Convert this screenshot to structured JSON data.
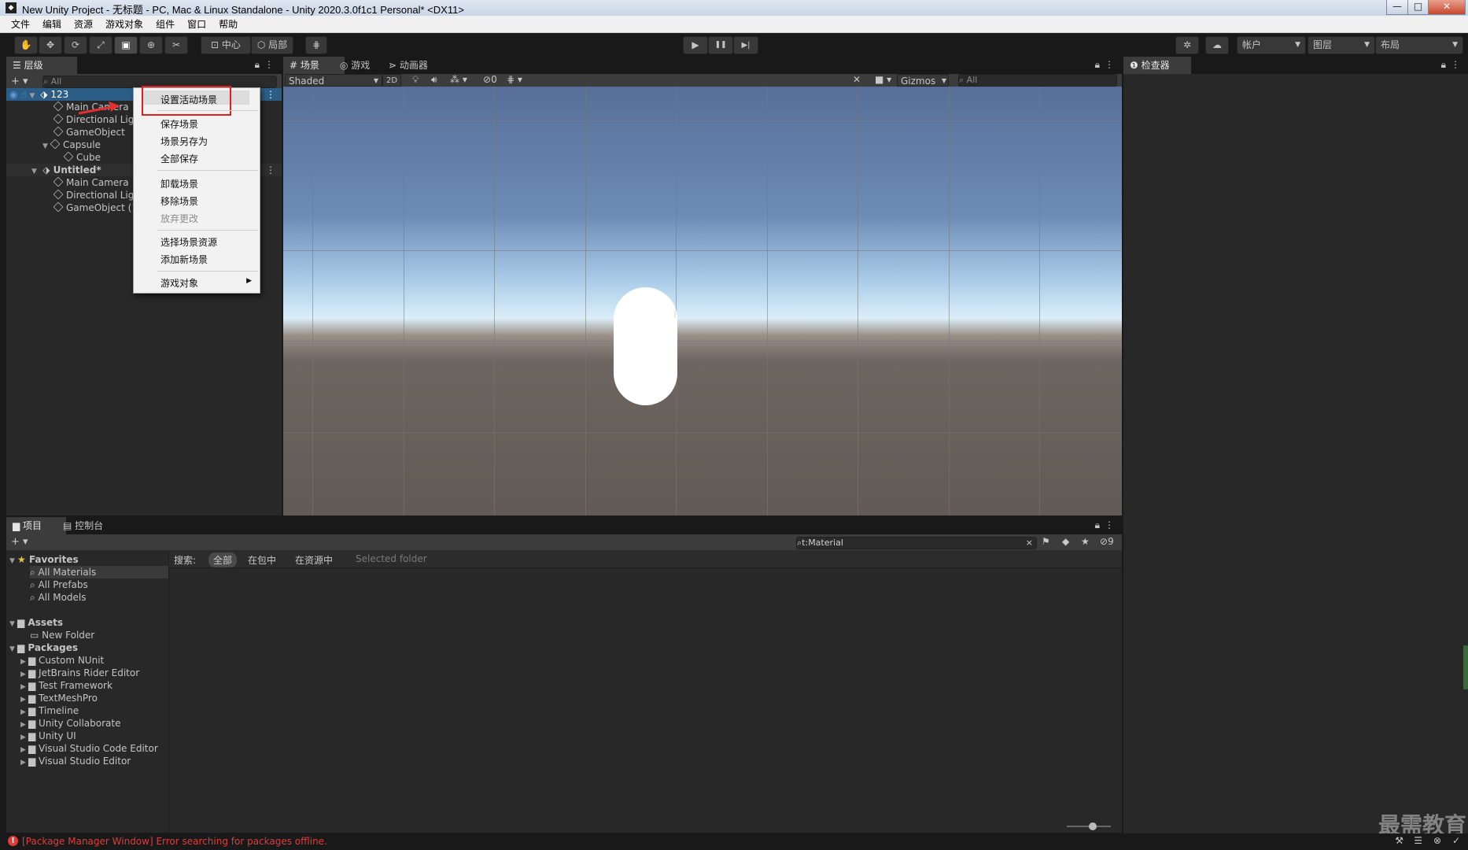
{
  "window": {
    "title": "New Unity Project - 无标题 - PC, Mac & Linux Standalone - Unity 2020.3.0f1c1 Personal* <DX11>",
    "minimize": "—",
    "maximize": "□",
    "close": "✕"
  },
  "menu": [
    "文件",
    "编辑",
    "资源",
    "游戏对象",
    "组件",
    "窗口",
    "帮助"
  ],
  "toolbar": {
    "center": "中心",
    "local": "局部",
    "account": "帐户",
    "layers": "图层",
    "layout": "布局",
    "play": "▶",
    "pause": "❚❚",
    "step": "▶|"
  },
  "hierarchy": {
    "tab": "层级",
    "search_placeholder": "All",
    "add": "+ ▾",
    "scene1": {
      "name": "123",
      "items": [
        "Main Camera",
        "Directional Light",
        "GameObject",
        "Capsule",
        "Cube"
      ]
    },
    "scene2": {
      "name": "Untitled*",
      "items": [
        "Main Camera",
        "Directional Light",
        "GameObject (1)"
      ]
    }
  },
  "context_menu": {
    "items": [
      {
        "label": "设置活动场景",
        "disabled": false,
        "highlight": true
      },
      {
        "label": "保存场景",
        "disabled": false
      },
      {
        "label": "场景另存为",
        "disabled": false
      },
      {
        "label": "全部保存",
        "disabled": false
      },
      {
        "label": "卸载场景",
        "disabled": false
      },
      {
        "label": "移除场景",
        "disabled": false
      },
      {
        "label": "放弃更改",
        "disabled": true
      },
      {
        "label": "选择场景资源",
        "disabled": false
      },
      {
        "label": "添加新场景",
        "disabled": false
      },
      {
        "label": "游戏对象",
        "disabled": false,
        "submenu": true
      }
    ],
    "highlight_color": "#e02020"
  },
  "scene_panel": {
    "tabs": [
      "场景",
      "游戏",
      "动画器"
    ],
    "shading": "Shaded",
    "mode_2d": "2D",
    "hidden_count": "0",
    "gizmos": "Gizmos",
    "search_placeholder": "All",
    "sky_color": "#6c8cb6",
    "ground_color": "#6d6560"
  },
  "inspector": {
    "tab": "检查器"
  },
  "project": {
    "tabs": [
      "项目",
      "控制台"
    ],
    "search_value": "t:Material",
    "badge_count": "9",
    "search_bar": {
      "label": "搜索:",
      "options": [
        "全部",
        "在包中",
        "在资源中",
        "Selected folder"
      ]
    },
    "favorites": {
      "label": "Favorites",
      "items": [
        "All Materials",
        "All Prefabs",
        "All Models"
      ]
    },
    "assets": {
      "label": "Assets",
      "items": [
        "New Folder"
      ]
    },
    "packages": {
      "label": "Packages",
      "items": [
        "Custom NUnit",
        "JetBrains Rider Editor",
        "Test Framework",
        "TextMeshPro",
        "Timeline",
        "Unity Collaborate",
        "Unity UI",
        "Visual Studio Code Editor",
        "Visual Studio Editor"
      ]
    }
  },
  "status": {
    "error": "[Package Manager Window] Error searching for packages offline.",
    "error_color": "#e03c3c"
  },
  "watermark": "最需教育"
}
